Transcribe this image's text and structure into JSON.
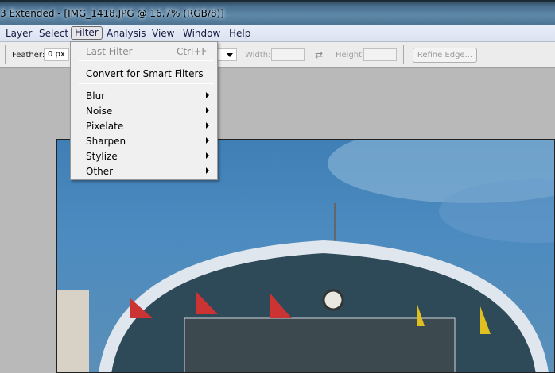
{
  "window": {
    "title": "3 Extended - [IMG_1418.JPG @ 16.7% (RGB/8)]"
  },
  "menubar": [
    "Layer",
    "Select",
    "Filter",
    "Analysis",
    "View",
    "Window",
    "Help"
  ],
  "options": {
    "feather_label": "Feather:",
    "feather_value": "0 px",
    "width_label": "Width:",
    "height_label": "Height:",
    "refine_label": "Refine Edge..."
  },
  "filter_menu": {
    "last_filter": "Last Filter",
    "last_filter_shortcut": "Ctrl+F",
    "convert": "Convert for Smart Filters",
    "submenus": [
      "Blur",
      "Noise",
      "Pixelate",
      "Sharpen",
      "Stylize",
      "Other"
    ]
  }
}
